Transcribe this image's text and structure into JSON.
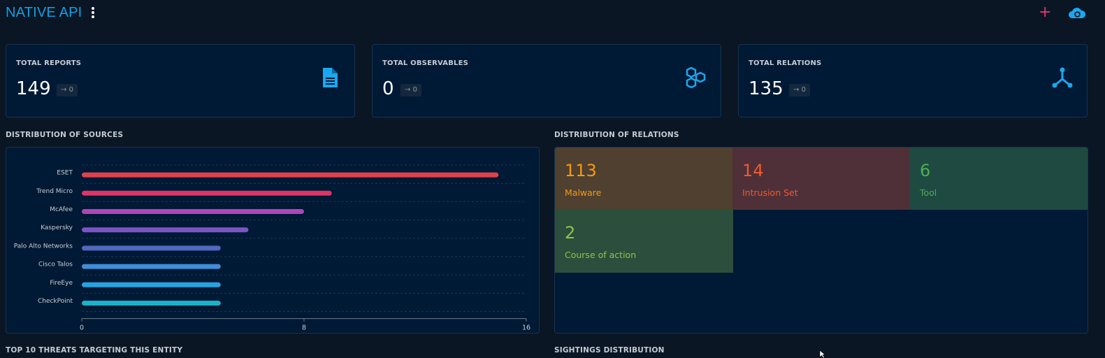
{
  "header": {
    "title": "NATIVE API",
    "menu_icon": "dots-vertical-icon",
    "add_icon": "plus-icon",
    "add_label": "+",
    "cloud_icon": "cloud-refresh-icon"
  },
  "cards": [
    {
      "label": "TOTAL REPORTS",
      "value": "149",
      "delta": "0",
      "icon": "document-icon"
    },
    {
      "label": "TOTAL OBSERVABLES",
      "value": "0",
      "delta": "0",
      "icon": "hexagons-icon"
    },
    {
      "label": "TOTAL RELATIONS",
      "value": "135",
      "delta": "0",
      "icon": "graph-icon"
    }
  ],
  "sections": {
    "sources": "DISTRIBUTION OF SOURCES",
    "relations": "DISTRIBUTION OF RELATIONS",
    "threats": "TOP 10 THREATS TARGETING THIS ENTITY",
    "sightings": "SIGHTINGS DISTRIBUTION"
  },
  "chart_data": {
    "type": "bar",
    "orientation": "horizontal",
    "categories": [
      "ESET",
      "Trend Micro",
      "McAfee",
      "Kaspersky",
      "Palo Alto Networks",
      "Cisco Talos",
      "FireEye",
      "CheckPoint"
    ],
    "values": [
      15,
      9,
      8,
      6,
      5,
      5,
      5,
      5
    ],
    "colors": [
      "#e0424d",
      "#dc3566",
      "#ae46b9",
      "#7c55c4",
      "#5068c0",
      "#3f8ed8",
      "#27a3e0",
      "#1cb1ca"
    ],
    "xlim": [
      0,
      16
    ],
    "xticks": [
      "0",
      "8",
      "16"
    ],
    "grid": true
  },
  "relations_treemap": [
    {
      "value": "113",
      "label": "Malware",
      "bg": "#4f4030",
      "fg": "#f59a12"
    },
    {
      "value": "14",
      "label": "Intrusion Set",
      "bg": "#4f3038",
      "fg": "#f2592b"
    },
    {
      "value": "6",
      "label": "Tool",
      "bg": "#1f4a42",
      "fg": "#4caf50"
    },
    {
      "value": "2",
      "label": "Course of action",
      "bg": "#2b4f3c",
      "fg": "#8bc34a"
    }
  ]
}
